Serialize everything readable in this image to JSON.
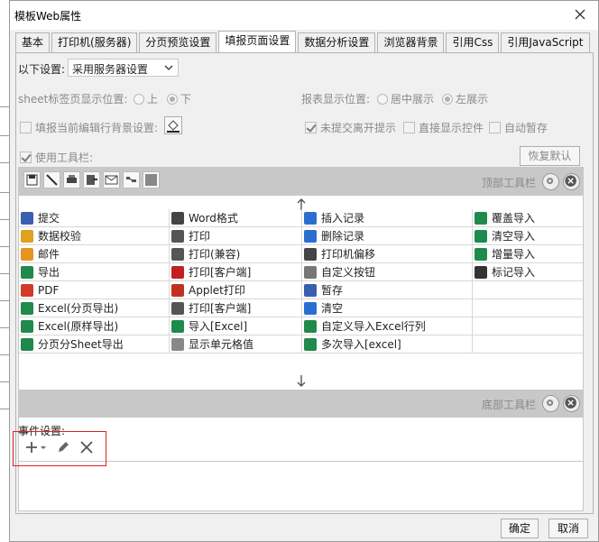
{
  "window": {
    "title": "模板Web属性"
  },
  "tabs": [
    {
      "label": "基本",
      "active": false
    },
    {
      "label": "打印机(服务器)",
      "active": false
    },
    {
      "label": "分页预览设置",
      "active": false
    },
    {
      "label": "填报页面设置",
      "active": true
    },
    {
      "label": "数据分析设置",
      "active": false
    },
    {
      "label": "浏览器背景",
      "active": false
    },
    {
      "label": "引用Css",
      "active": false
    },
    {
      "label": "引用JavaScript",
      "active": false
    }
  ],
  "settings": {
    "mode_label": "以下设置:",
    "mode_value": "采用服务器设置",
    "sheet_label": "sheet标签页显示位置:",
    "sheet_top": "上",
    "sheet_bottom": "下",
    "report_label": "报表显示位置:",
    "report_center": "居中展示",
    "report_left": "左展示",
    "edit_bg_label": "填报当前编辑行背景设置:",
    "unsubmitted_label": "未提交离开提示",
    "show_control_label": "直接显示控件",
    "autosave_label": "自动暂存",
    "use_toolbar_label": "使用工具栏:",
    "restore_default": "恢复默认"
  },
  "toolbar": {
    "top_label": "顶部工具栏",
    "bottom_label": "底部工具栏",
    "items": [
      [
        {
          "label": "提交",
          "icon": "submit-icon",
          "color": "#3a5fb0"
        },
        {
          "label": "Word格式",
          "icon": "word-icon",
          "color": "#444"
        },
        {
          "label": "插入记录",
          "icon": "insert-record-icon",
          "color": "#2a6fd0"
        },
        {
          "label": "覆盖导入",
          "icon": "excel-icon",
          "color": "#1f8a4c"
        }
      ],
      [
        {
          "label": "数据校验",
          "icon": "verify-icon",
          "color": "#e0a020"
        },
        {
          "label": "打印",
          "icon": "print-icon",
          "color": "#555"
        },
        {
          "label": "删除记录",
          "icon": "delete-record-icon",
          "color": "#2a6fd0"
        },
        {
          "label": "清空导入",
          "icon": "excel-icon",
          "color": "#1f8a4c"
        }
      ],
      [
        {
          "label": "邮件",
          "icon": "mail-icon",
          "color": "#e69520"
        },
        {
          "label": "打印(兼容)",
          "icon": "print-icon",
          "color": "#555"
        },
        {
          "label": "打印机偏移",
          "icon": "move-icon",
          "color": "#444"
        },
        {
          "label": "增量导入",
          "icon": "excel-icon",
          "color": "#1f8a4c"
        }
      ],
      [
        {
          "label": "导出",
          "icon": "export-icon",
          "color": "#1f8a4c"
        },
        {
          "label": "打印[客户端]",
          "icon": "pdf-print-icon",
          "color": "#c02020"
        },
        {
          "label": "自定义按钮",
          "icon": "gear-icon",
          "color": "#777"
        },
        {
          "label": "标记导入",
          "icon": "mark-excel-icon",
          "color": "#333"
        }
      ],
      [
        {
          "label": "PDF",
          "icon": "pdf-icon",
          "color": "#d23a2a"
        },
        {
          "label": "Applet打印",
          "icon": "java-icon",
          "color": "#c03020"
        },
        {
          "label": "暂存",
          "icon": "save-icon",
          "color": "#3a5fb0"
        },
        {
          "label": "",
          "icon": "",
          "color": ""
        }
      ],
      [
        {
          "label": "Excel(分页导出)",
          "icon": "excel-icon",
          "color": "#1f8a4c"
        },
        {
          "label": "打印[客户端]",
          "icon": "print-icon",
          "color": "#555"
        },
        {
          "label": "清空",
          "icon": "eraser-icon",
          "color": "#2a6fd0"
        },
        {
          "label": "",
          "icon": "",
          "color": ""
        }
      ],
      [
        {
          "label": "Excel(原样导出)",
          "icon": "excel-icon",
          "color": "#1f8a4c"
        },
        {
          "label": "导入[Excel]",
          "icon": "excel-icon",
          "color": "#1f8a4c"
        },
        {
          "label": "自定义导入Excel行列",
          "icon": "excel-icon",
          "color": "#1f8a4c"
        },
        {
          "label": "",
          "icon": "",
          "color": ""
        }
      ],
      [
        {
          "label": "分页分Sheet导出",
          "icon": "excel-icon",
          "color": "#1f8a4c"
        },
        {
          "label": "显示单元格值",
          "icon": "blank-icon",
          "color": "#888"
        },
        {
          "label": "多次导入[excel]",
          "icon": "excel-icon",
          "color": "#1f8a4c"
        },
        {
          "label": "",
          "icon": "",
          "color": ""
        }
      ]
    ]
  },
  "events": {
    "label": "事件设置:"
  },
  "buttons": {
    "ok": "确定",
    "cancel": "取消"
  }
}
